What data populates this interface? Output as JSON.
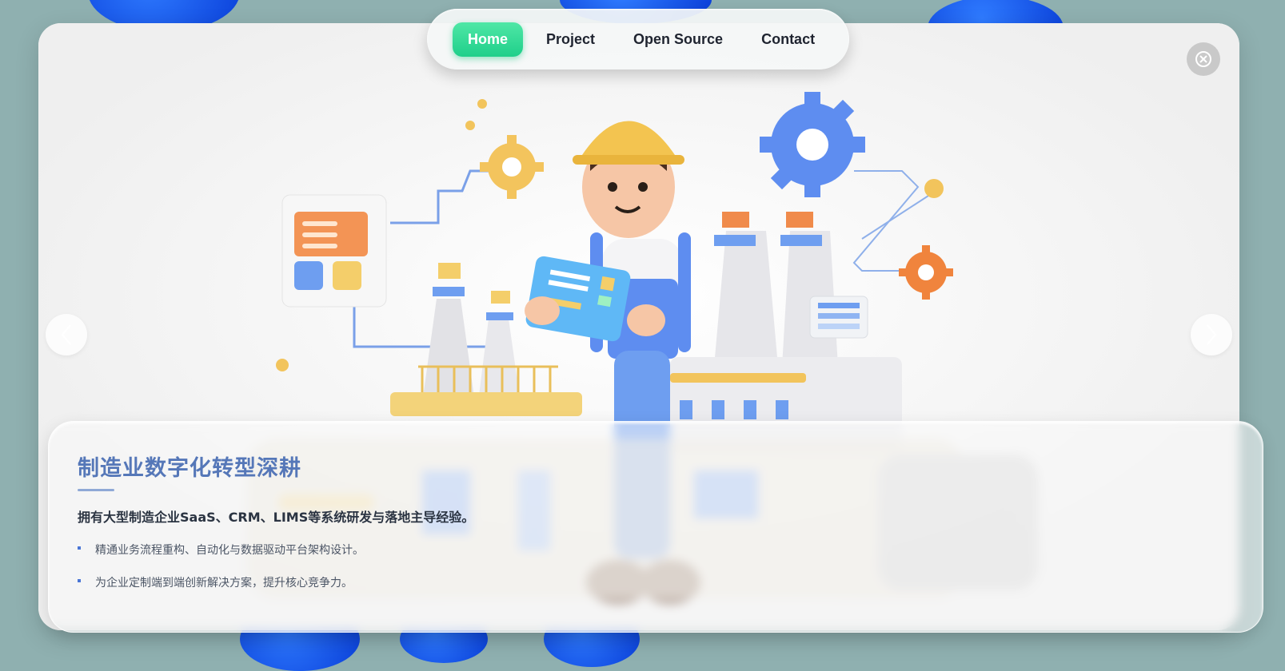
{
  "nav": {
    "items": [
      {
        "label": "Home",
        "active": true
      },
      {
        "label": "Project",
        "active": false
      },
      {
        "label": "Open Source",
        "active": false
      },
      {
        "label": "Contact",
        "active": false
      }
    ]
  },
  "icons": {
    "close": "close-circle-icon",
    "prev": "chevron-left-icon",
    "next": "chevron-right-icon"
  },
  "hero": {
    "title": "制造业数字化转型深耕",
    "lead": "拥有大型制造企业SaaS、CRM、LIMS等系统研发与落地主导经验。",
    "bullets": [
      "精通业务流程重构、自动化与数据驱动平台架构设计。",
      "为企业定制端到端创新解决方案，提升核心竞争力。"
    ]
  },
  "colors": {
    "accent_green": "#22d08c",
    "title_blue": "#5577b8",
    "background": "#8fb0b0"
  }
}
